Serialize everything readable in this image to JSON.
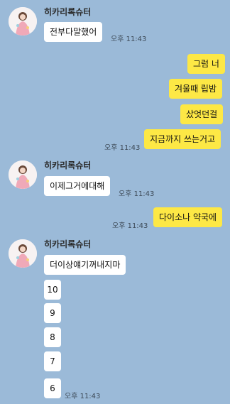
{
  "sender": {
    "name": "히카리록슈터",
    "avatar_icon": "profile-avatar-icon"
  },
  "colors": {
    "background": "#9bbad8",
    "incoming_bubble": "#ffffff",
    "outgoing_bubble": "#fde845"
  },
  "messages": [
    {
      "direction": "in",
      "text": "전부다말했어",
      "time": "오후 11:43"
    },
    {
      "direction": "out",
      "text": "그럼 너"
    },
    {
      "direction": "out",
      "text": "겨울때 립밤"
    },
    {
      "direction": "out",
      "text": "샀엇던걸"
    },
    {
      "direction": "out",
      "text": "지금까지 쓰는거고",
      "time": "오후 11:43"
    },
    {
      "direction": "in",
      "text": "이제그거에대해",
      "time": "오후 11:43"
    },
    {
      "direction": "out",
      "text": "다이소나 약국에",
      "time": "오후 11:43"
    },
    {
      "direction": "in",
      "text": "더이상얘기꺼내지마"
    },
    {
      "direction": "in",
      "text": "10"
    },
    {
      "direction": "in",
      "text": "9"
    },
    {
      "direction": "in",
      "text": "8"
    },
    {
      "direction": "in",
      "text": "7"
    },
    {
      "direction": "in",
      "text": "6",
      "time": "오후 11:43"
    }
  ]
}
